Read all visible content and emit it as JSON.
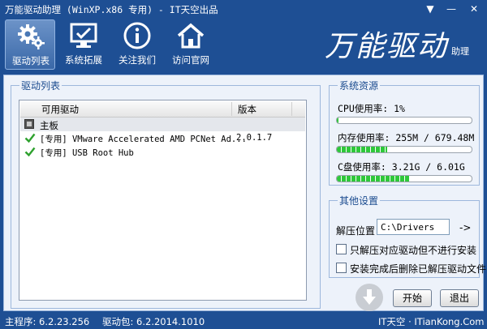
{
  "window": {
    "title": "万能驱动助理 (WinXP.x86 专用) - IT天空出品",
    "controls": {
      "menu": "▼",
      "minimize": "—",
      "close": "✕"
    }
  },
  "nav": [
    {
      "label": "驱动列表",
      "icon": "gears-icon",
      "active": true
    },
    {
      "label": "系统拓展",
      "icon": "monitor-icon",
      "active": false
    },
    {
      "label": "关注我们",
      "icon": "info-icon",
      "active": false
    },
    {
      "label": "访问官网",
      "icon": "home-icon",
      "active": false
    }
  ],
  "brand": {
    "title": "万能驱动",
    "subtitle": "助理"
  },
  "driver_list": {
    "group_title": "驱动列表",
    "columns": [
      "可用驱动",
      "版本"
    ],
    "rows": [
      {
        "type": "group",
        "name": "主板",
        "version": ""
      },
      {
        "type": "item",
        "name": "[专用] VMware Accelerated AMD PCNet Ad...",
        "version": "2.0.1.7",
        "checked": true
      },
      {
        "type": "item",
        "name": "[专用] USB Root Hub",
        "version": "",
        "checked": true
      }
    ]
  },
  "resources": {
    "group_title": "系统资源",
    "cpu": {
      "label": "CPU使用率:  1%",
      "percent": 1
    },
    "memory": {
      "label": "内存使用率: 255M / 679.48M",
      "percent": 37.5
    },
    "disk": {
      "label": "C盘使用率:  3.21G / 6.01G",
      "percent": 53.4
    }
  },
  "other_settings": {
    "group_title": "其他设置",
    "path_label": "解压位置",
    "path_value": "C:\\Drivers",
    "path_button": "->",
    "option1": "只解压对应驱动但不进行安装",
    "option2": "安装完成后删除已解压驱动文件"
  },
  "buttons": {
    "start": "开始",
    "exit": "退出"
  },
  "status": {
    "main": "主程序: 6.2.23.256",
    "package": "驱动包: 6.2.2014.1010",
    "site": "IT天空 · ITianKong.Com"
  },
  "colors": {
    "chrome": "#1e4f94",
    "content": "#edf2fa",
    "progress": "#2ec83a"
  }
}
